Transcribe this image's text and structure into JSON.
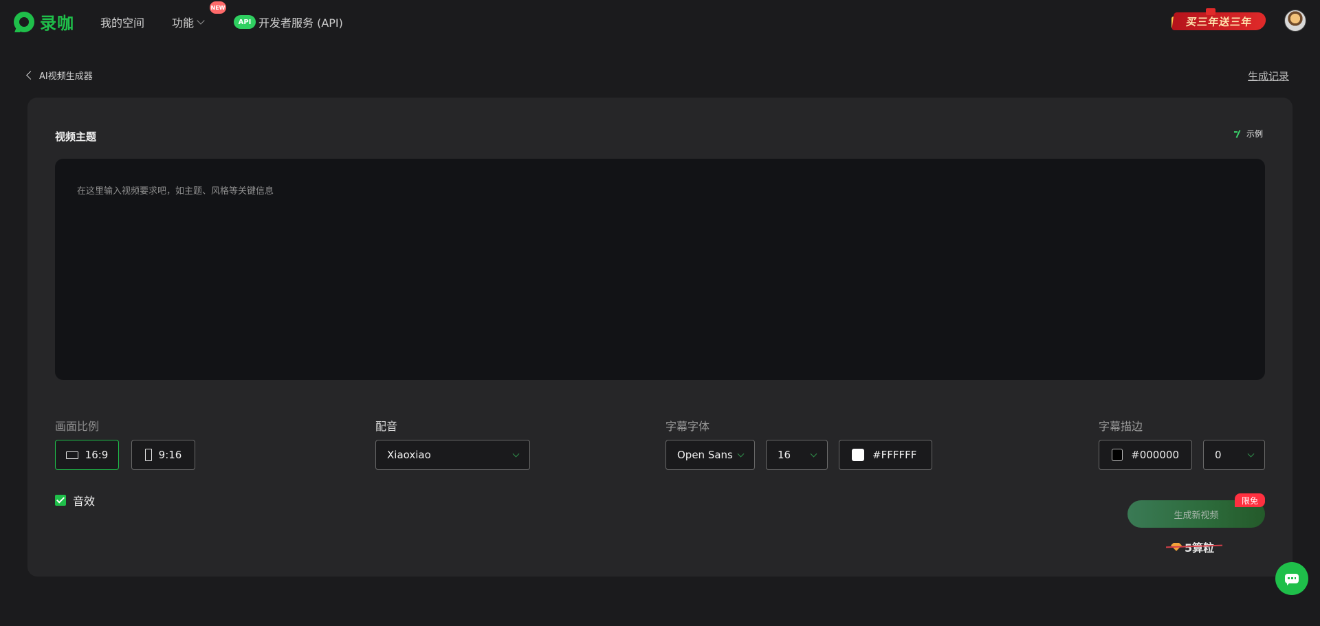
{
  "brand": {
    "name": "录咖",
    "accent": "#1fbf4a"
  },
  "nav": {
    "my_space": "我的空间",
    "features": "功能",
    "new_badge": "NEW",
    "api_icon_text": "API",
    "developer_api": "开发者服务 (API)",
    "promo": "买三年送三年"
  },
  "breadcrumb": {
    "back_label": "AI视频生成器",
    "history": "生成记录"
  },
  "topic": {
    "title": "视频主题",
    "example": "示例",
    "placeholder": "在这里输入视频要求吧，如主题、风格等关键信息"
  },
  "aspect_ratio": {
    "label": "画面比例",
    "options": [
      "16:9",
      "9:16"
    ],
    "selected": "16:9"
  },
  "voice": {
    "label": "配音",
    "value": "Xiaoxiao"
  },
  "subtitle_font": {
    "label": "字幕字体",
    "family": "Open Sans",
    "size": "16",
    "color": "#FFFFFF"
  },
  "subtitle_stroke": {
    "label": "字幕描边",
    "color": "#000000",
    "width": "0"
  },
  "sound_effect": {
    "label": "音效",
    "checked": true
  },
  "generate": {
    "label": "生成新视频",
    "badge": "限免",
    "cost": "5算粒"
  }
}
